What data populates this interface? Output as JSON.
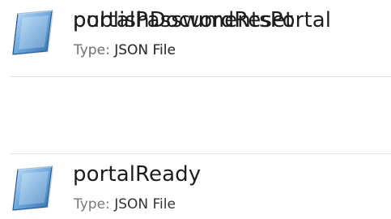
{
  "files": [
    {
      "name": "portalPasswordReset",
      "type_label": "Type:",
      "type_value": "JSON File",
      "icon": "notepad-document-icon"
    },
    {
      "name": "portalReady",
      "type_label": "Type:",
      "type_value": "JSON File",
      "icon": "notepad-document-icon"
    },
    {
      "name": "publishDocumentsPortal",
      "type_label": "Type:",
      "type_value": "JSON File",
      "icon": "notepad-document-icon"
    }
  ],
  "colors": {
    "icon_blue_dark": "#2f6fb0",
    "icon_blue_light": "#9cc8ee",
    "icon_page": "#ffffff",
    "divider": "#e3e3e3"
  }
}
